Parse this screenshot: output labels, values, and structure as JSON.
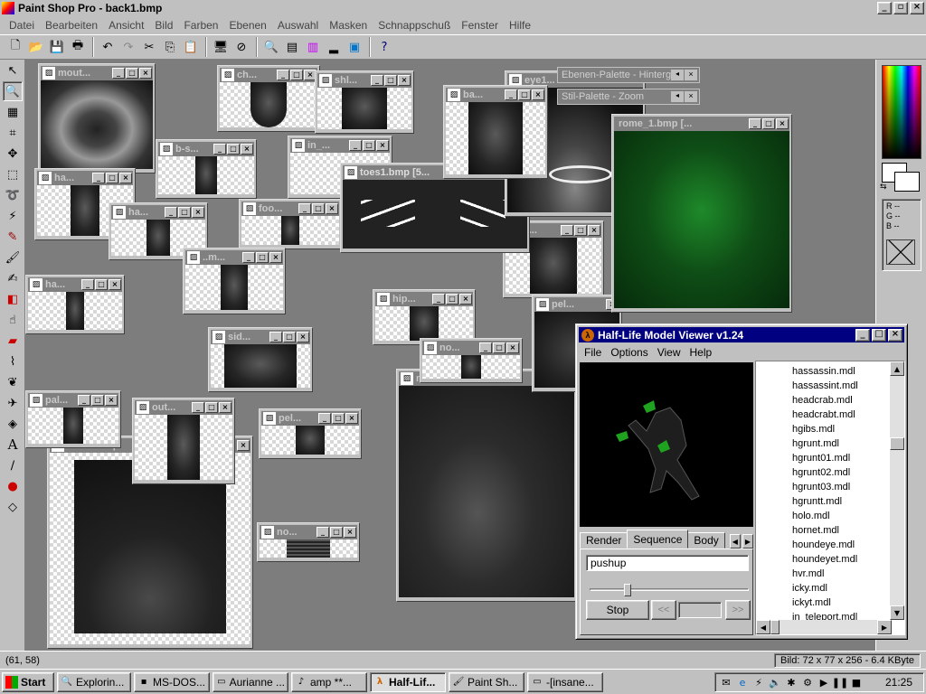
{
  "app": {
    "title": "Paint Shop Pro - back1.bmp"
  },
  "menu": [
    "Datei",
    "Bearbeiten",
    "Ansicht",
    "Bild",
    "Farben",
    "Ebenen",
    "Auswahl",
    "Masken",
    "Schnappschuß",
    "Fenster",
    "Hilfe"
  ],
  "image_windows": [
    {
      "title": "mout..."
    },
    {
      "title": "ch..."
    },
    {
      "title": "shl..."
    },
    {
      "title": "ba..."
    },
    {
      "title": "eye1..."
    },
    {
      "title": "b-s..."
    },
    {
      "title": "in_..."
    },
    {
      "title": "ha..."
    },
    {
      "title": "ha..."
    },
    {
      "title": "foo..."
    },
    {
      "title": "toes1.bmp [5..."
    },
    {
      "title": "g..."
    },
    {
      "title": "rome_1.bmp [..."
    },
    {
      "title": "ha..."
    },
    {
      "title": "..m..."
    },
    {
      "title": "hip..."
    },
    {
      "title": "pel..."
    },
    {
      "title": "no..."
    },
    {
      "title": "sid..."
    },
    {
      "title": "pal..."
    },
    {
      "title": "out..."
    },
    {
      "title": "pel..."
    },
    {
      "title": "no..."
    },
    {
      "title": "back1.bmp"
    }
  ],
  "palettes": {
    "layers": "Ebenen-Palette - Hintergr...",
    "styles": "Stil-Palette - Zoom"
  },
  "right_panel": {
    "r": "R --",
    "g": "G --",
    "b": "B --"
  },
  "status": {
    "coords": "(61, 58)",
    "image_info": "Bild:  72 x 77 x 256 - 6.4 KByte"
  },
  "hlmv": {
    "title": "Half-Life Model Viewer v1.24",
    "menu": [
      "File",
      "Options",
      "View",
      "Help"
    ],
    "tabs": [
      "Render",
      "Sequence",
      "Body"
    ],
    "sequence_value": "pushup",
    "stop_label": "Stop",
    "prev_label": "<<",
    "next_label": ">>",
    "models": [
      "hassassin.mdl",
      "hassassint.mdl",
      "headcrab.mdl",
      "headcrabt.mdl",
      "hgibs.mdl",
      "hgrunt.mdl",
      "hgrunt01.mdl",
      "hgrunt02.mdl",
      "hgrunt03.mdl",
      "hgruntt.mdl",
      "holo.mdl",
      "hornet.mdl",
      "houndeye.mdl",
      "houndeyet.mdl",
      "hvr.mdl",
      "icky.mdl",
      "ickyt.mdl",
      "in_teleport.mdl"
    ]
  },
  "taskbar": {
    "start": "Start",
    "tasks": [
      "Explorin...",
      "MS-DOS...",
      "Aurianne ...",
      "amp **...",
      "Half-Lif...",
      "Paint Sh...",
      "-[insane..."
    ],
    "clock": "21:25"
  }
}
